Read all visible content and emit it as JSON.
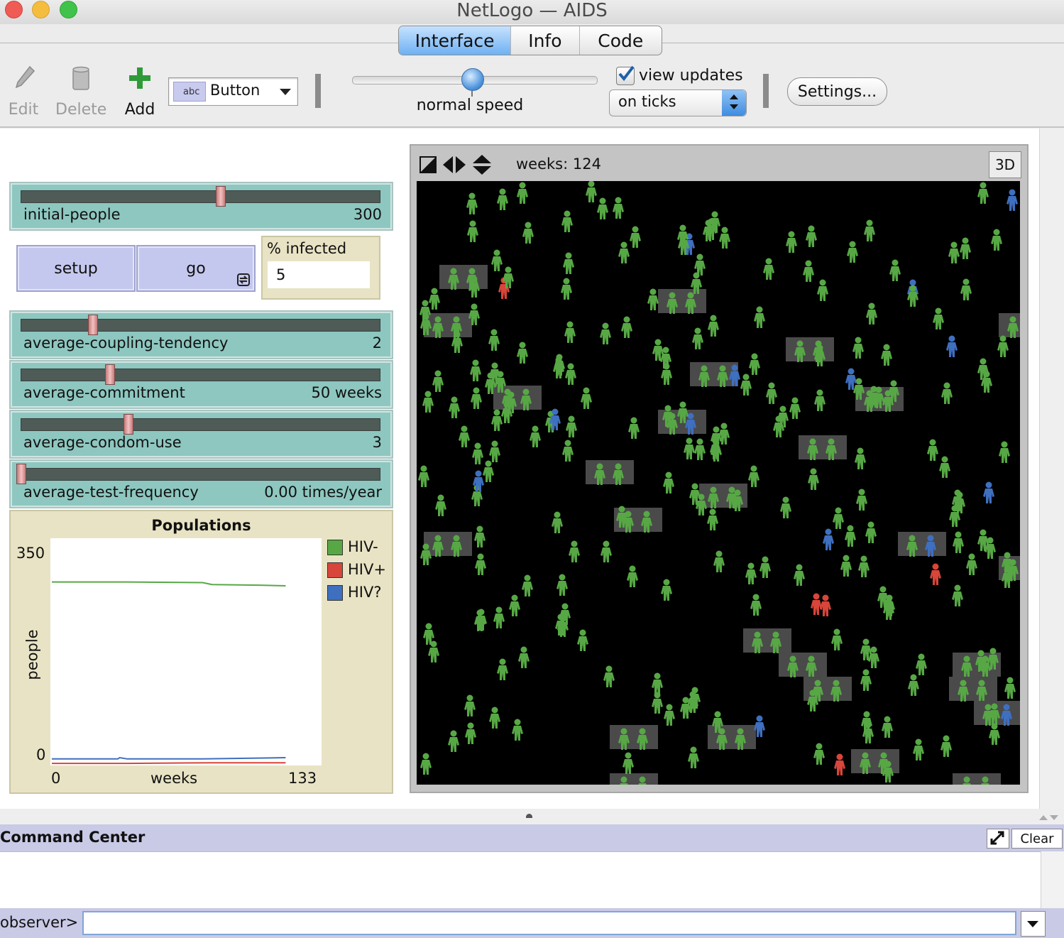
{
  "window": {
    "title": "NetLogo — AIDS",
    "traffic_lights": [
      "#ee5c55",
      "#f5bd3e",
      "#41c34b"
    ]
  },
  "tabs": [
    {
      "label": "Interface",
      "active": true
    },
    {
      "label": "Info",
      "active": false
    },
    {
      "label": "Code",
      "active": false
    }
  ],
  "toolbar": {
    "edit_label": "Edit",
    "delete_label": "Delete",
    "add_label": "Add",
    "widget_type": "Button",
    "widget_icon_text": "abc",
    "speed_label": "normal speed",
    "speed_value": 0.5,
    "view_updates_label": "view updates",
    "view_updates_checked": true,
    "update_mode": "on ticks",
    "settings_label": "Settings..."
  },
  "sliders": {
    "initial_people": {
      "name": "initial-people",
      "value": "300",
      "fraction": 0.55
    },
    "coupling": {
      "name": "average-coupling-tendency",
      "value": "2",
      "fraction": 0.2
    },
    "commitment": {
      "name": "average-commitment",
      "value": "50 weeks",
      "fraction": 0.25
    },
    "condom": {
      "name": "average-condom-use",
      "value": "3",
      "fraction": 0.3
    },
    "test": {
      "name": "average-test-frequency",
      "value": "0.00 times/year",
      "fraction": 0.0
    }
  },
  "buttons": {
    "setup": "setup",
    "go": "go"
  },
  "monitor": {
    "label": "% infected",
    "value": "5"
  },
  "plot": {
    "title": "Populations",
    "y_max_label": "350",
    "y_min_label": "0",
    "x_min_label": "0",
    "x_label": "weeks",
    "x_max_label": "133",
    "y_label": "people",
    "legend": [
      {
        "name": "HIV-",
        "color": "#57a845"
      },
      {
        "name": "HIV+",
        "color": "#d8453a"
      },
      {
        "name": "HIV?",
        "color": "#3f6fbf"
      }
    ]
  },
  "chart_data": {
    "type": "line",
    "title": "Populations",
    "xlabel": "weeks",
    "ylabel": "people",
    "xlim": [
      0,
      133
    ],
    "ylim": [
      0,
      350
    ],
    "series": [
      {
        "name": "HIV-",
        "color": "#57a845",
        "x": [
          0,
          40,
          80,
          85,
          110,
          124
        ],
        "y": [
          284,
          284,
          283,
          280,
          279,
          278
        ]
      },
      {
        "name": "HIV+",
        "color": "#d8453a",
        "x": [
          0,
          40,
          85,
          124
        ],
        "y": [
          1,
          1,
          2,
          2
        ]
      },
      {
        "name": "HIV?",
        "color": "#3f6fbf",
        "x": [
          0,
          35,
          36,
          40,
          80,
          124
        ],
        "y": [
          8,
          8,
          10,
          8,
          8,
          10
        ]
      }
    ]
  },
  "view": {
    "ticks_label": "weeks: 124",
    "three_d_label": "3D"
  },
  "command_center": {
    "title": "Command Center",
    "clear_label": "Clear",
    "prompt": "observer>",
    "input_value": ""
  },
  "colors": {
    "hiv_negative": "#57a845",
    "hiv_positive": "#d8453a",
    "hiv_unknown": "#3f6fbf",
    "slider": "#8dc7c0",
    "button": "#c5c8ee",
    "monitor": "#e8e3c4"
  }
}
